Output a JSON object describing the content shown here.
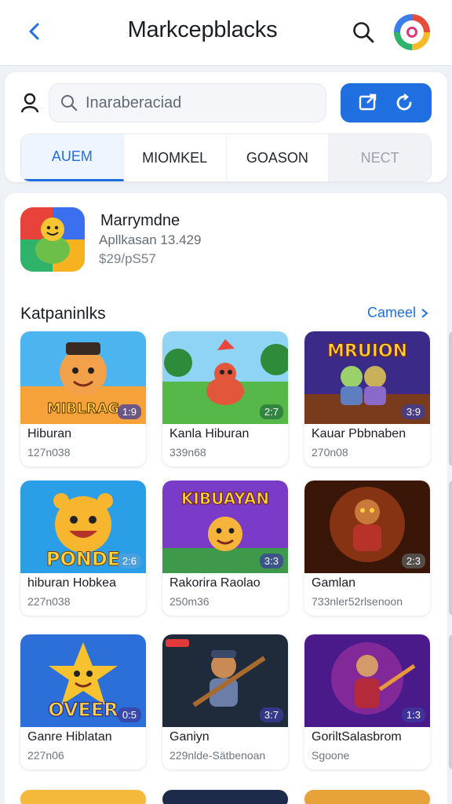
{
  "header": {
    "title": "Markcepblacks",
    "back_icon": "chevron-left-icon",
    "search_icon": "search-icon",
    "avatar_icon": "app-avatar"
  },
  "toolbar": {
    "search_placeholder": "Inaraberaciad",
    "user_icon": "user-icon",
    "action_icons": [
      "share-icon",
      "refresh-icon"
    ],
    "accent_color": "#1f6fe0"
  },
  "tabs": [
    {
      "label": "AUEM",
      "active": true
    },
    {
      "label": "MIOMKEL",
      "active": false
    },
    {
      "label": "GOASON",
      "active": false
    },
    {
      "label": "NECT",
      "active": false
    }
  ],
  "featured": {
    "name": "Marrymdne",
    "subtitle": "Apllkasan 13.429",
    "price": "$29/pS57"
  },
  "section": {
    "title": "Katpaninlks",
    "link_label": "Cameel"
  },
  "cards": [
    {
      "title": "Hiburan",
      "meta": "127n038",
      "badge": "1:9",
      "thumb_text": "MIBLRAG"
    },
    {
      "title": "Kanla Hiburan",
      "meta": "339n68",
      "badge": "2:7",
      "thumb_text": ""
    },
    {
      "title": "Kauar Pbbnaben",
      "meta": "270n08",
      "badge": "3:9",
      "thumb_text": "MRUION"
    },
    {
      "title": "hiburan Hobkea",
      "meta": "227n038",
      "badge": "2:6",
      "thumb_text": "PONDE"
    },
    {
      "title": "Rakorira Raolao",
      "meta": "250m36",
      "badge": "3:3",
      "thumb_text": "KIBUAYAN"
    },
    {
      "title": "Gamlan",
      "meta": "733nler52rlsenoon",
      "badge": "2:3",
      "thumb_text": ""
    },
    {
      "title": "Ganre Hiblatan",
      "meta": "227n06",
      "badge": "0:5",
      "thumb_text": "OVEER"
    },
    {
      "title": "Ganiyn",
      "meta": "229nlde-Sätbenoan",
      "badge": "3:7",
      "thumb_text": ""
    },
    {
      "title": "GoriltSalasbrom",
      "meta": "Sgoone",
      "badge": "1:3",
      "thumb_text": ""
    }
  ]
}
